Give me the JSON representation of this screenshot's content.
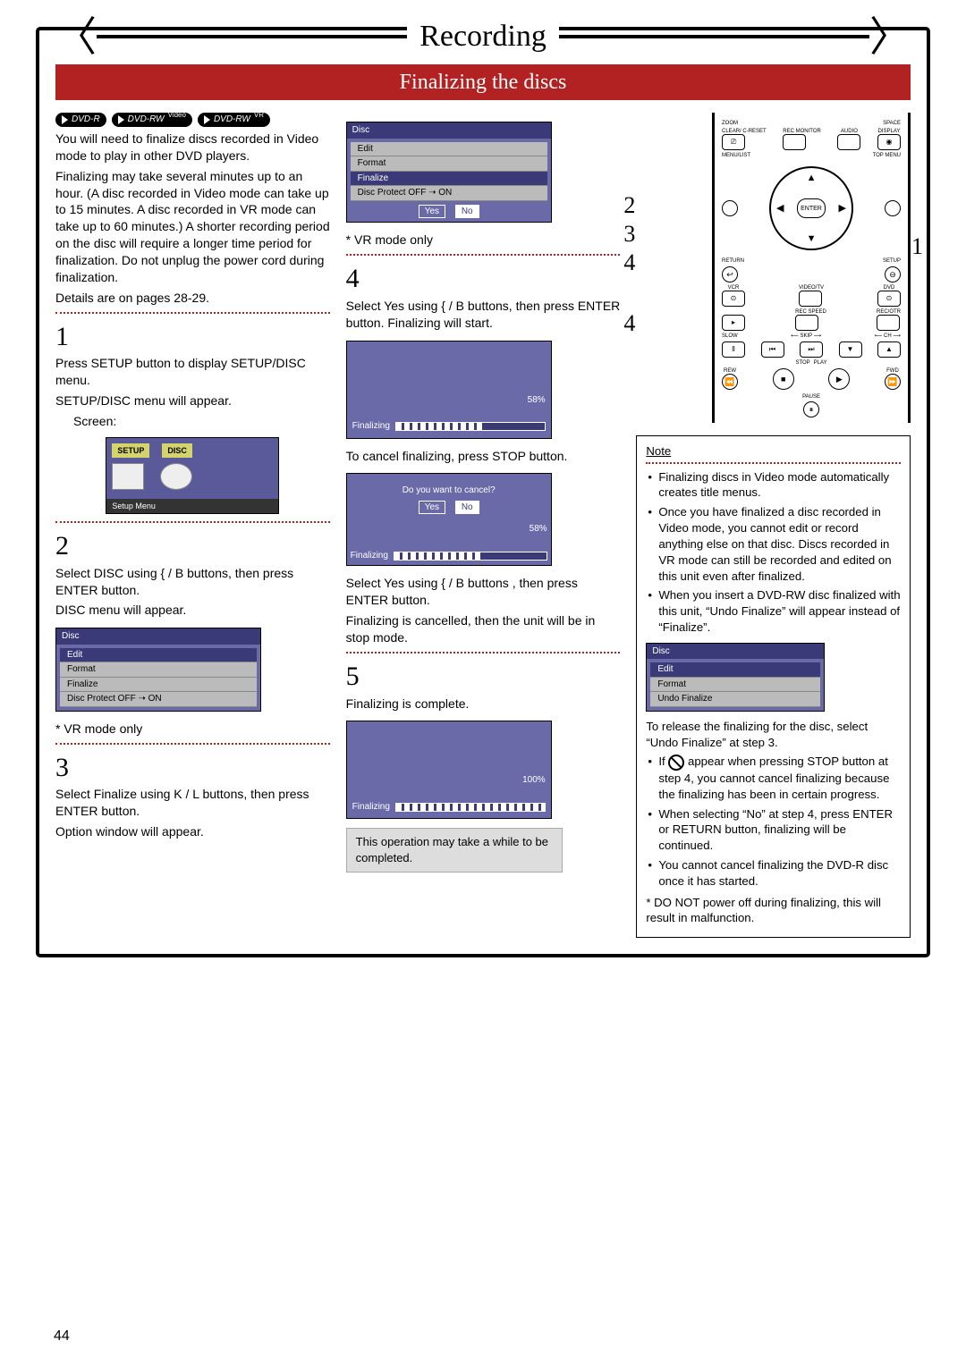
{
  "page": {
    "title": "Recording",
    "section": "Finalizing the discs",
    "number": "44"
  },
  "badges": [
    {
      "label": "DVD-R"
    },
    {
      "label": "DVD-RW",
      "sup": "Video"
    },
    {
      "label": "DVD-RW",
      "sup": "VR"
    }
  ],
  "intro": {
    "p1": "You will need to finalize discs recorded in Video mode to play in other DVD players.",
    "p2": "Finalizing may take several minutes up to an hour. (A disc recorded in Video mode can take up to 15 minutes. A disc recorded in VR mode can take up to 60 minutes.) A shorter recording period on the disc will require a longer time period for finalization. Do not unplug the power cord during finalization.",
    "p3": "Details are on pages 28-29."
  },
  "steps": {
    "s1": {
      "num": "1",
      "a": "Press SETUP button to display SETUP/DISC menu.",
      "b": "SETUP/DISC menu will appear.",
      "c": "Screen:",
      "screen": {
        "tab1": "SETUP",
        "tab2": "DISC",
        "caption": "Setup Menu"
      }
    },
    "s2": {
      "num": "2",
      "a": "Select DISC using { / B buttons, then press ENTER button.",
      "b": "DISC menu will appear.",
      "menu": {
        "title": "Disc",
        "items": [
          "Edit",
          "Format",
          "Finalize",
          "Disc Protect OFF ➝ ON"
        ],
        "footnote": "* VR mode only"
      }
    },
    "s3": {
      "num": "3",
      "a": "Select Finalize using K / L buttons, then press ENTER button.",
      "b": "Option window will appear.",
      "menu": {
        "title": "Disc",
        "items": [
          "Edit",
          "Format",
          "Finalize",
          "Disc Protect OFF ➝ ON"
        ],
        "yes": "Yes",
        "no": "No",
        "footnote": "* VR mode only"
      }
    },
    "s4": {
      "num": "4",
      "a": "Select Yes using { / B buttons, then press ENTER button. Finalizing will start.",
      "prog1": {
        "label": "Finalizing",
        "pct": "58%",
        "fill": 58
      },
      "b": "To cancel finalizing, press STOP button.",
      "cancel": {
        "q": "Do you want to cancel?",
        "yes": "Yes",
        "no": "No",
        "label": "Finalizing",
        "pct": "58%",
        "fill": 58
      },
      "c": "Select Yes using { / B buttons , then press ENTER button.",
      "d": "Finalizing is cancelled, then the unit will be in stop mode."
    },
    "s5": {
      "num": "5",
      "a": "Finalizing is complete.",
      "prog": {
        "label": "Finalizing",
        "pct": "100%",
        "fill": 100
      },
      "msg": "This operation may take a while to be completed."
    }
  },
  "remote": {
    "row1": [
      "ZOOM",
      "SPACE"
    ],
    "row2": [
      "CLEAR/ C-RESET",
      "REC MONITOR",
      "AUDIO",
      "DISPLAY"
    ],
    "row3": [
      "MENU/LIST",
      "TOP MENU"
    ],
    "enter": "ENTER",
    "row4": [
      "RETURN",
      "SETUP"
    ],
    "row5": [
      "VCR",
      "VIDEO/TV",
      "DVD"
    ],
    "row6": [
      "",
      "REC SPEED",
      "REC/OTR"
    ],
    "row7l": "SLOW",
    "row7m": "SKIP",
    "row7r": "CH",
    "row8": [
      "REW",
      "STOP",
      "PLAY",
      "FWD"
    ],
    "pause": "PAUSE",
    "leads": {
      "l1": "1",
      "l2": "2",
      "l3": "3",
      "l4a": "4",
      "l4b": "4"
    }
  },
  "note": {
    "title": "Note",
    "items": [
      "Finalizing discs in Video mode automatically creates title menus.",
      "Once you have finalized a disc recorded in Video mode, you cannot edit or record anything else on that disc. Discs recorded in VR mode can still be recorded and edited on this unit even after finalized.",
      "When you insert a DVD-RW disc finalized with this unit, “Undo Finalize” will appear instead of “Finalize”."
    ],
    "menu": {
      "title": "Disc",
      "items": [
        "Edit",
        "Format",
        "Undo Finalize"
      ]
    },
    "after": "To release the finalizing for the disc, select “Undo Finalize” at step 3.",
    "items2": [
      "If ⃠ appear when pressing STOP button at step 4, you cannot cancel finalizing because the finalizing has been in certain progress.",
      "When selecting “No” at step 4, press ENTER or RETURN button, finalizing will be continued.",
      "You cannot cancel finalizing the DVD-R disc once it has started."
    ],
    "star": "* DO NOT power off during finalizing, this will result in malfunction."
  }
}
